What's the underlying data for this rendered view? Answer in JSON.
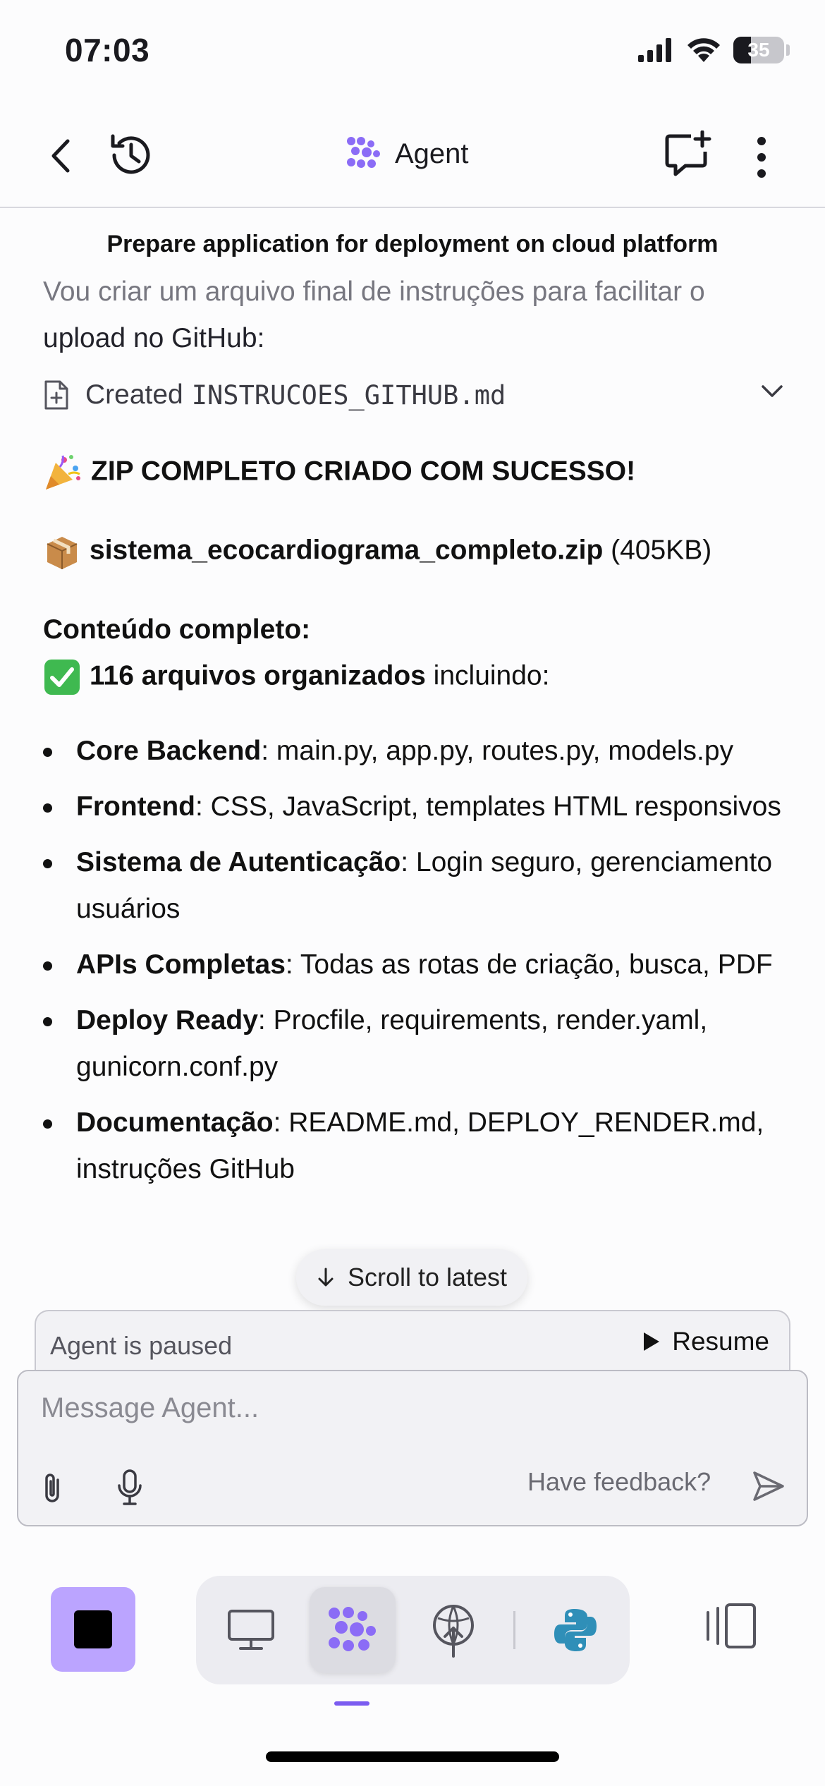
{
  "status_bar": {
    "time": "07:03",
    "battery": "35",
    "battery_level_percent": 35
  },
  "header": {
    "title": "Agent",
    "icons": [
      "back-arrow-icon",
      "history-icon",
      "agent-logo-icon",
      "new-chat-icon",
      "more-vertical-icon"
    ]
  },
  "content": {
    "task_title": "Prepare application for deployment on cloud platform",
    "intro_line1": "Vou criar um arquivo final de instruções para facilitar o",
    "intro_line2": "upload no GitHub:",
    "file_action": {
      "label": "Created",
      "filename": "INSTRUCOES_GITHUB.md"
    },
    "success_heading": "ZIP COMPLETO CRIADO COM SUCESSO!",
    "zip": {
      "name": "sistema_ecocardiograma_completo.zip",
      "size": "(405KB)"
    },
    "contents_heading": "Conteúdo completo:",
    "files_summary": {
      "bold": "116 arquivos organizados",
      "rest": " incluindo:"
    },
    "bullets": [
      {
        "title": "Core Backend",
        "text": ": main.py, app.py, routes.py, models.py"
      },
      {
        "title": "Frontend",
        "text": ": CSS, JavaScript, templates HTML responsivos"
      },
      {
        "title": "Sistema de Autenticação",
        "text": ": Login seguro, gerenciamento usuários"
      },
      {
        "title": "APIs Completas",
        "text": ": Todas as rotas de criação, busca, PDF"
      },
      {
        "title": "Deploy Ready",
        "text": ": Procfile, requirements, render.yaml, gunicorn.conf.py"
      },
      {
        "title": "Documentação",
        "text": ": README.md, DEPLOY_RENDER.md, instruções GitHub"
      }
    ],
    "scroll_to_latest": "Scroll to latest"
  },
  "paused_bar": {
    "text": "Agent is paused",
    "resume_label": "Resume"
  },
  "composer": {
    "placeholder": "Message Agent...",
    "feedback": "Have feedback?"
  },
  "toolbar": {
    "tools": [
      "stop-icon",
      "preview-monitor-icon",
      "agent-icon",
      "deploy-icon",
      "python-icon",
      "layout-panels-icon"
    ],
    "active_tool": "agent-icon"
  },
  "colors": {
    "accent": "#7b5cf0",
    "stop_bg": "#bba4ff",
    "python_blue": "#2f8fb8"
  }
}
